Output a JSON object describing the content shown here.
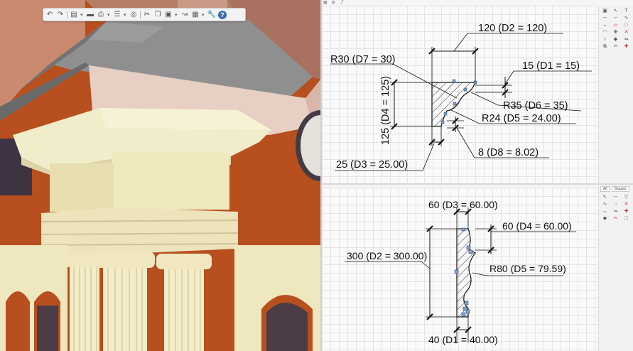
{
  "toolbar": {
    "icons": [
      "undo-icon",
      "redo-icon",
      "copy-icon",
      "view-icon",
      "print-icon",
      "render-icon",
      "layers-icon",
      "cut-icon",
      "copy-sheet-icon",
      "paste-icon",
      "link-icon",
      "paste-special-icon",
      "wrench-icon",
      "help-icon"
    ],
    "help_label": "?"
  },
  "top_panel": {
    "tabs": [
      "▦",
      "⊞",
      "⤴"
    ],
    "dimensions": {
      "d2": "120 (D2 = 120)",
      "d7": "R30 (D7 = 30)",
      "d1": "15 (D1 = 15)",
      "d6": "R35 (D6 = 35)",
      "d4": "125 (D4 = 125)",
      "d5": "R24 (D5 = 24.00)",
      "d8": "8 (D8 = 8.02)",
      "d3": "25 (D3 = 25.00)"
    }
  },
  "bottom_panel": {
    "side_tabs": [
      "All",
      "Shapes"
    ],
    "dimensions": {
      "d3": "60 (D3 = 60.00)",
      "d4": "60 (D4 = 60.00)",
      "d2": "300 (D2 = 300.00)",
      "d5": "R80 (D5 = 79.59)",
      "d1": "40 (D1 = 40.00)"
    }
  },
  "colors": {
    "wall": "#b74f1e",
    "cream": "#f1ecc9",
    "roof": "#8a8a8a",
    "soffit": "#e8cfc4",
    "accent": "#3b6fb0"
  }
}
